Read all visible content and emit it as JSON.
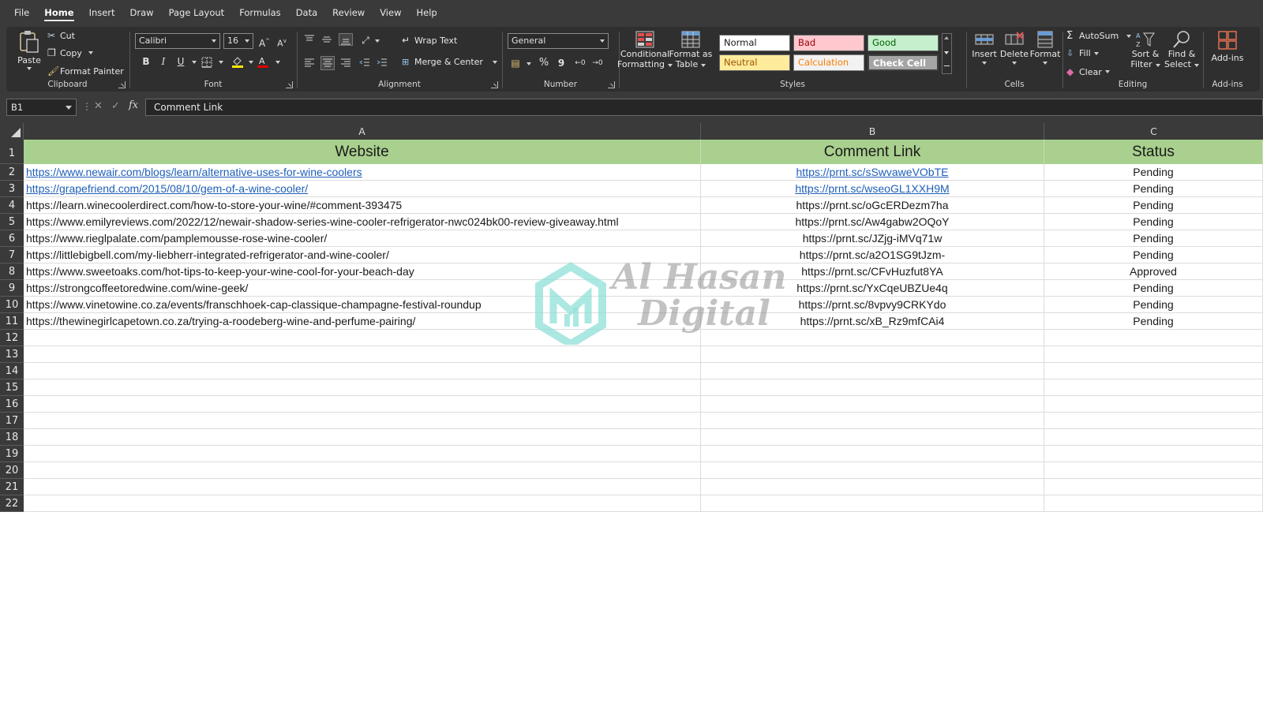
{
  "menu": {
    "tabs": [
      "File",
      "Home",
      "Insert",
      "Draw",
      "Page Layout",
      "Formulas",
      "Data",
      "Review",
      "View",
      "Help"
    ],
    "active": "Home"
  },
  "ribbon": {
    "clipboard": {
      "label": "Clipboard",
      "paste": "Paste",
      "cut": "Cut",
      "copy": "Copy",
      "format_painter": "Format Painter"
    },
    "font": {
      "label": "Font",
      "family": "Calibri",
      "size": "16",
      "bold": "B",
      "italic": "I",
      "underline": "U"
    },
    "alignment": {
      "label": "Alignment",
      "wrap_text": "Wrap Text",
      "merge_center": "Merge & Center"
    },
    "number": {
      "label": "Number",
      "format": "General",
      "percent": "%",
      "comma": "9"
    },
    "styles": {
      "label": "Styles",
      "conditional": "Conditional",
      "conditional2": "Formatting",
      "format_table": "Format as",
      "format_table2": "Table",
      "normal": "Normal",
      "bad": "Bad",
      "good": "Good",
      "neutral": "Neutral",
      "calculation": "Calculation",
      "check_cell": "Check Cell"
    },
    "cells": {
      "label": "Cells",
      "insert": "Insert",
      "delete": "Delete",
      "format": "Format"
    },
    "editing": {
      "label": "Editing",
      "autosum": "AutoSum",
      "fill": "Fill",
      "clear": "Clear",
      "sort": "Sort &",
      "sort2": "Filter",
      "find": "Find &",
      "find2": "Select"
    },
    "addins": {
      "label": "Add-ins",
      "addins": "Add-ins"
    }
  },
  "formula_bar": {
    "name_box": "B1",
    "fx": "fx",
    "content": "Comment Link"
  },
  "sheet": {
    "columns": [
      "A",
      "B",
      "C"
    ],
    "row_numbers": [
      "1",
      "2",
      "3",
      "4",
      "5",
      "6",
      "7",
      "8",
      "9",
      "10",
      "11",
      "12",
      "13",
      "14",
      "15",
      "16",
      "17",
      "18",
      "19",
      "20",
      "21",
      "22"
    ],
    "header": [
      "Website",
      "Comment Link",
      "Status"
    ],
    "rows": [
      [
        "https://www.newair.com/blogs/learn/alternative-uses-for-wine-coolers",
        "https://prnt.sc/sSwvaweVObTE",
        "Pending"
      ],
      [
        "https://grapefriend.com/2015/08/10/gem-of-a-wine-cooler/",
        "https://prnt.sc/wseoGL1XXH9M",
        "Pending"
      ],
      [
        "https://learn.winecoolerdirect.com/how-to-store-your-wine/#comment-393475",
        "https://prnt.sc/oGcERDezm7ha",
        "Pending"
      ],
      [
        "https://www.emilyreviews.com/2022/12/newair-shadow-series-wine-cooler-refrigerator-nwc024bk00-review-giveaway.html",
        "https://prnt.sc/Aw4gabw2OQoY",
        "Pending"
      ],
      [
        "https://www.rieglpalate.com/pamplemousse-rose-wine-cooler/",
        "https://prnt.sc/JZjg-iMVq71w",
        "Pending"
      ],
      [
        "https://littlebigbell.com/my-liebherr-integrated-refrigerator-and-wine-cooler/",
        "https://prnt.sc/a2O1SG9tJzm-",
        "Pending"
      ],
      [
        "https://www.sweetoaks.com/hot-tips-to-keep-your-wine-cool-for-your-beach-day",
        "https://prnt.sc/CFvHuzfut8YA",
        "Approved"
      ],
      [
        "https://strongcoffeetoredwine.com/wine-geek/",
        "https://prnt.sc/YxCqeUBZUe4q",
        "Pending"
      ],
      [
        "https://www.vinetowine.co.za/events/franschhoek-cap-classique-champagne-festival-roundup",
        "https://prnt.sc/8vpvy9CRKYdo",
        "Pending"
      ],
      [
        "https://thewinegirlcapetown.co.za/trying-a-roodeberg-wine-and-perfume-pairing/",
        "https://prnt.sc/xB_Rz9mfCAi4",
        "Pending"
      ]
    ],
    "hyperlink_rows": [
      0,
      1
    ]
  },
  "watermark": {
    "line1": "Al Hasan",
    "line2": "Digital",
    "color": "#7fd6cf"
  }
}
